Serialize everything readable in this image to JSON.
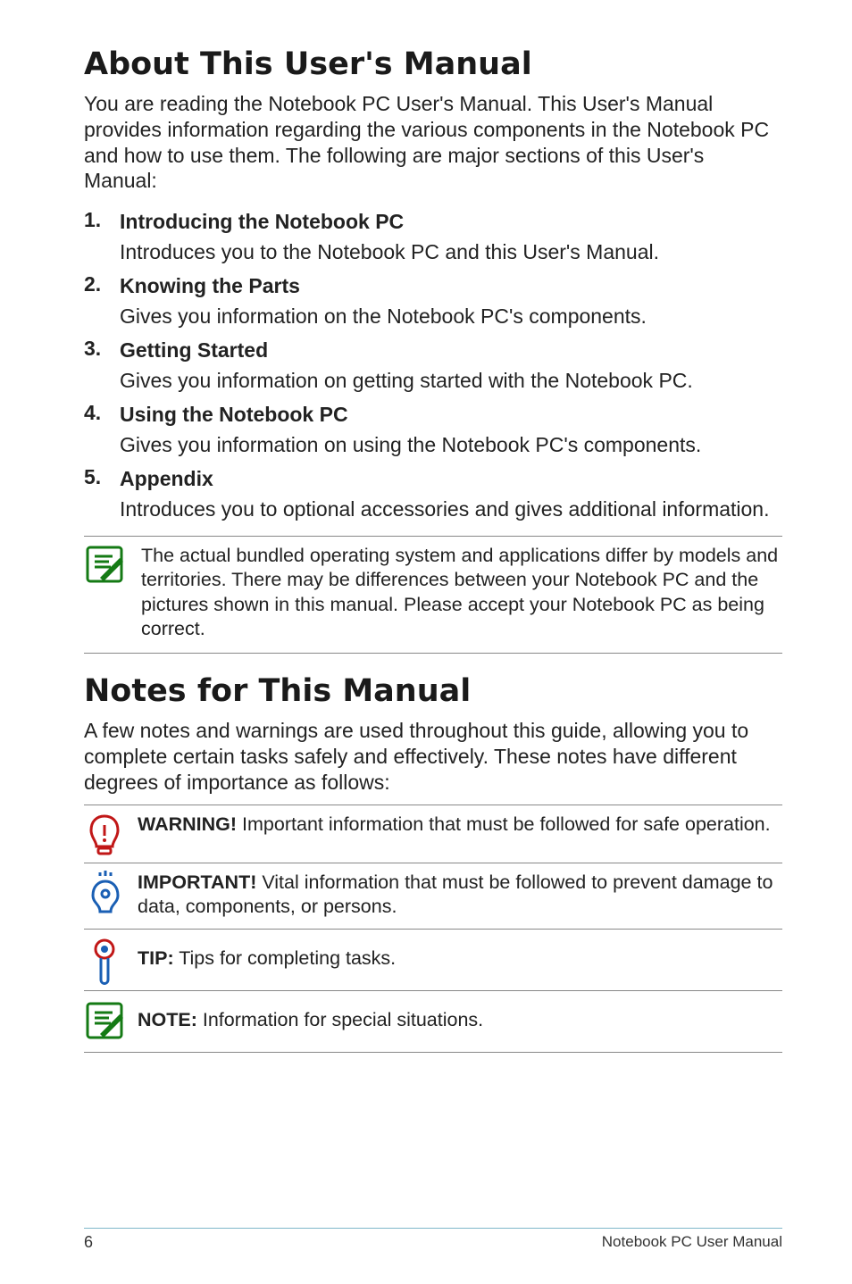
{
  "heading1": "About This User's Manual",
  "intro": "You are reading the Notebook PC User's Manual. This User's Manual provides information regarding the various components in the Notebook PC and how to use them. The following are major sections of this User's Manual:",
  "sections": [
    {
      "title": "Introducing the Notebook PC",
      "desc": "Introduces you to the Notebook PC and this User's Manual."
    },
    {
      "title": "Knowing the Parts",
      "desc": "Gives you information on the Notebook PC's components."
    },
    {
      "title": "Getting Started",
      "desc": "Gives you information on getting started with the Notebook PC."
    },
    {
      "title": "Using the Notebook PC",
      "desc": "Gives you information on using the Notebook PC's components."
    },
    {
      "title": "Appendix",
      "desc": "Introduces you to optional accessories and gives additional information."
    }
  ],
  "note_box": "The actual bundled operating system and applications differ by models and territories. There may be differences between your Notebook PC and the pictures shown in this manual. Please accept your Notebook PC as being correct.",
  "heading2": "Notes for This Manual",
  "notes_intro": "A few notes and warnings are used throughout this guide, allowing you to complete certain tasks safely and effectively. These notes have different degrees of importance as follows:",
  "callouts": {
    "warning_label": "WARNING!",
    "warning_text": " Important information that must be followed for safe operation.",
    "important_label": "IMPORTANT!",
    "important_text": " Vital information that must be followed to prevent damage to data, components, or persons.",
    "tip_label": "TIP:",
    "tip_text": " Tips for completing tasks.",
    "note_label": "NOTE:",
    "note_text": "  Information for special situations."
  },
  "footer": {
    "page": "6",
    "title": "Notebook PC User Manual"
  }
}
